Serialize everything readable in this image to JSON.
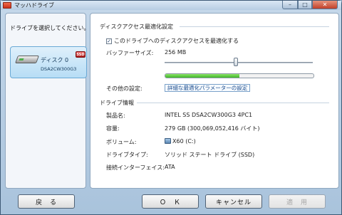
{
  "window": {
    "title": "マッハドライブ",
    "min_glyph": "–",
    "max_glyph": "□",
    "close_glyph": "✕"
  },
  "left": {
    "heading": "ドライブを選択してください。",
    "drive": {
      "name": "ディスク 0",
      "model": "DSA2CW300G3",
      "badge": "SSD"
    }
  },
  "access": {
    "section_title": "ディスクアクセス最適化設定",
    "checkbox_label": "このドライブへのディスクアクセスを最適化する",
    "checkbox_checked": true,
    "buffer_label": "バッファーサイズ:",
    "buffer_value": "256 MB",
    "slider_level": 0.47,
    "progress_level": 0.5,
    "other_label": "その他の設定:",
    "other_link": "詳細な最適化パラメーターの設定"
  },
  "info": {
    "section_title": "ドライブ情報",
    "rows": [
      {
        "label": "製品名:",
        "value": "INTEL SS DSA2CW300G3    4PC1"
      },
      {
        "label": "容量:",
        "value": "279  GB  (300,069,052,416 バイト)"
      },
      {
        "label": "ボリューム:",
        "value": "X60 (C:)"
      },
      {
        "label": "ドライブタイプ:",
        "value": "ソリッド  ステート  ドライブ (SSD)"
      },
      {
        "label": "接続インターフェイス:",
        "value": "ATA"
      }
    ]
  },
  "buttons": {
    "back": "戻　る",
    "ok": "Ｏ　Ｋ",
    "cancel": "キャンセル",
    "apply": "適　用"
  }
}
